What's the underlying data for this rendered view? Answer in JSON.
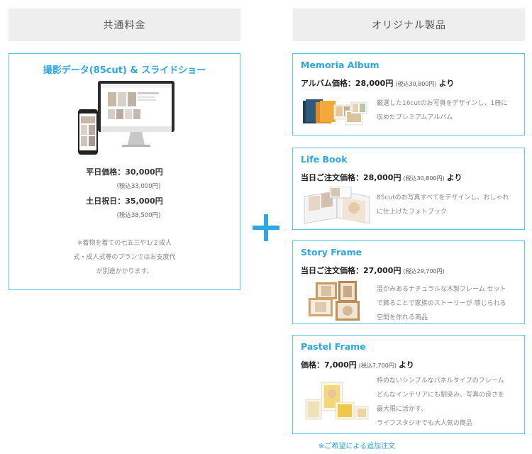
{
  "headers": {
    "left": "共通料金",
    "right": "オリジナル製品"
  },
  "left_card": {
    "title": "撮影データ(85cut) & スライドショー",
    "weekday_price": "平日価格：30,000円",
    "weekday_tax": "(税込33,000円)",
    "holiday_price": "土日祝日：35,000円",
    "holiday_tax": "(税込38,500円)",
    "note_lines": [
      "※着物を着ての七五三や1/２成人",
      "式・成人式等のプランではお支度代",
      "が別途かかります。"
    ]
  },
  "products": [
    {
      "title": "Memoria Album",
      "price_label": "アルバム価格：28,000円",
      "tax": "(税込30,800円)",
      "suffix": "より",
      "desc": [
        "厳選した16cutのお写真をデザインし、1冊に",
        "収めたプレミアムアルバム"
      ]
    },
    {
      "title": "Life Book",
      "price_label": "当日ご注文価格：28,000円",
      "tax": "(税込30,800円)",
      "suffix": "より",
      "desc": [
        "85cutのお写真すべてをデザインし、おしゃれ",
        "に仕上げたフォトブック"
      ]
    },
    {
      "title": "Story Frame",
      "price_label": "当日ご注文価格：27,000円",
      "tax": "(税込29,700円)",
      "suffix": "",
      "desc": [
        "温かみあるナチュラルな木製フレーム セット",
        "で飾ることで家族のストーリーが 感じられる",
        "空間を作れる商品"
      ]
    },
    {
      "title": "Pastel Frame",
      "price_label": "価格：7,000円",
      "tax": "(税込7,700円)",
      "suffix": "より",
      "desc": [
        "枠のないシンプルなパネルタイプのフレーム",
        "どんなインテリアにも馴染み、写真の良さを",
        "最大限に活かす、",
        "ライフスタジオでも大人気の商品"
      ]
    }
  ],
  "footnote": "※ご希望による追加注文",
  "colors": {
    "accent": "#2ea7e0",
    "border": "#5cc3e8",
    "header_bg": "#eeeeee"
  }
}
